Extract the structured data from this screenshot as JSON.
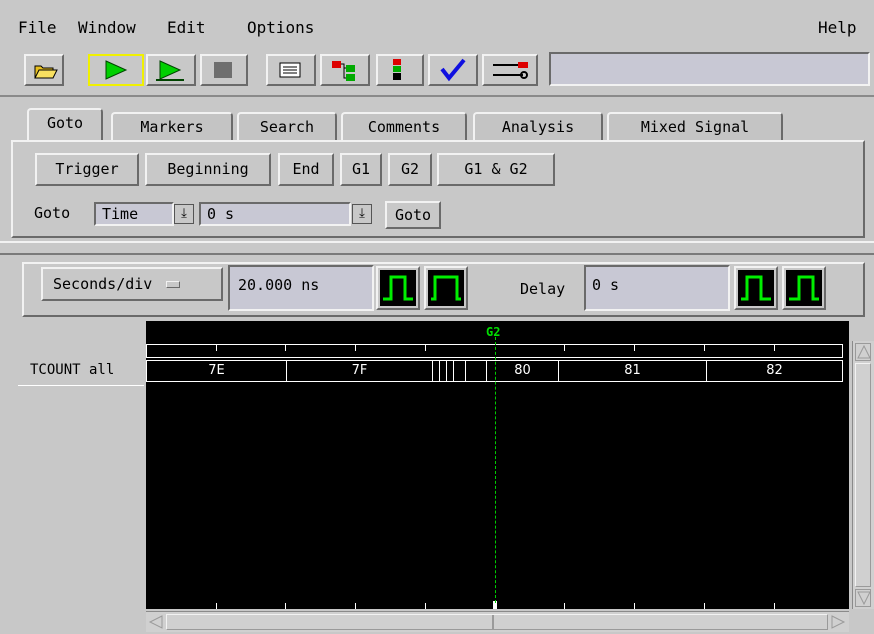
{
  "menubar": {
    "items": [
      "File",
      "Window",
      "Edit",
      "Options"
    ],
    "help": "Help"
  },
  "toolbar": {
    "buttons": [
      "open-folder",
      "run-single",
      "run-repetitive",
      "stop",
      "listing",
      "overview",
      "markers-window",
      "checkmark",
      "properties"
    ],
    "status_text": ""
  },
  "tabs": [
    "Goto",
    "Markers",
    "Search",
    "Comments",
    "Analysis",
    "Mixed Signal"
  ],
  "goto_panel": {
    "buttons": [
      "Trigger",
      "Beginning",
      "End",
      "G1",
      "G2",
      "G1 & G2"
    ],
    "goto_label": "Goto",
    "mode_value": "Time",
    "position_value": "0 s",
    "goto_button": "Goto"
  },
  "timebase": {
    "scale_label": "Seconds/div",
    "scale_value": "20.000 ns",
    "delay_label": "Delay",
    "delay_value": "0 s"
  },
  "waveform": {
    "marker_label": "G2",
    "signal_name": "TCOUNT all",
    "bus_values": [
      "7E",
      "7F",
      "80",
      "81",
      "82"
    ],
    "colors": {
      "background": "#000000",
      "marker": "#00cc00",
      "trace": "#ffffff",
      "pulse": "#00ee00"
    }
  }
}
